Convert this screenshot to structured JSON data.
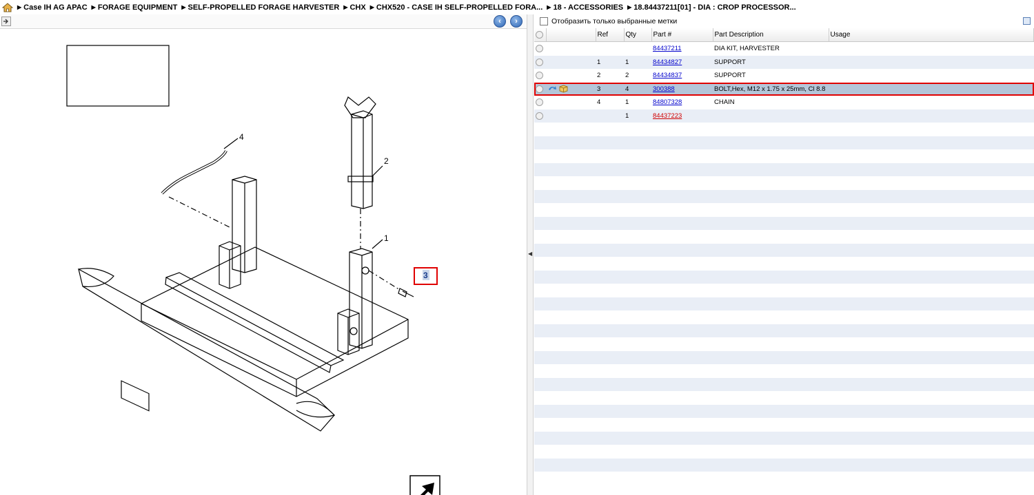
{
  "breadcrumb": {
    "items": [
      "Case IH AG APAC",
      "FORAGE EQUIPMENT",
      "SELF-PROPELLED FORAGE HARVESTER",
      "CHX",
      "CHX520 - CASE IH SELF-PROPELLED FORA...",
      "18 - ACCESSORIES",
      "18.84437211[01] - DIA : CROP PROCESSOR..."
    ]
  },
  "diagram": {
    "callouts": [
      "1",
      "2",
      "3",
      "4"
    ],
    "highlighted_callout": "3"
  },
  "filter": {
    "label": "Отобразить только выбранные метки",
    "checked": false
  },
  "table": {
    "headers": {
      "ref": "Ref",
      "qty": "Qty",
      "part": "Part #",
      "desc": "Part Description",
      "usage": "Usage"
    },
    "rows": [
      {
        "ref": "",
        "qty": "",
        "part": "84437211",
        "desc": "DIA KIT, HARVESTER",
        "usage": ""
      },
      {
        "ref": "1",
        "qty": "1",
        "part": "84434827",
        "desc": "SUPPORT",
        "usage": ""
      },
      {
        "ref": "2",
        "qty": "2",
        "part": "84434837",
        "desc": "SUPPORT",
        "usage": ""
      },
      {
        "ref": "3",
        "qty": "4",
        "part": "300388",
        "desc": "BOLT,Hex, M12 x 1.75 x 25mm, Cl 8.8",
        "usage": ""
      },
      {
        "ref": "4",
        "qty": "1",
        "part": "84807328",
        "desc": "CHAIN",
        "usage": ""
      },
      {
        "ref": "",
        "qty": "1",
        "part": "84437223",
        "desc": "",
        "usage": ""
      }
    ],
    "selected_row": 3,
    "red_link_row": 5
  },
  "colors": {
    "selection": "#b4c6d9",
    "highlight_border": "#e00000",
    "link": "#0000cc",
    "link_red": "#d00000"
  }
}
